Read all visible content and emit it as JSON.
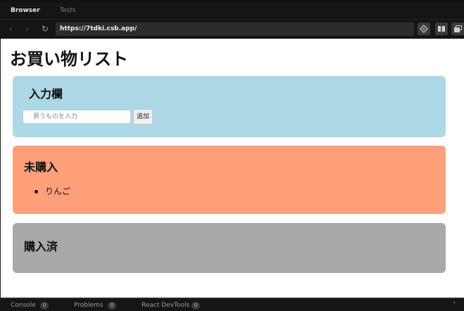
{
  "tabs": [
    {
      "label": "Browser"
    },
    {
      "label": "Tests"
    }
  ],
  "toolbar": {
    "url": "https://7tdki.csb.app/"
  },
  "page": {
    "title": "お買い物リスト",
    "input_section": {
      "title": "入力欄",
      "input_placeholder": "買うものを入力",
      "input_value": "",
      "add_button_label": "追加"
    },
    "unbought_section": {
      "title": "未購入",
      "items": [
        "りんご"
      ]
    },
    "bought_section": {
      "title": "購入済",
      "items": []
    }
  },
  "devtools": {
    "tabs": [
      {
        "label": "Console",
        "count": "0"
      },
      {
        "label": "Problems",
        "count": "0"
      },
      {
        "label": "React DevTools",
        "count": "0"
      }
    ]
  },
  "colors": {
    "input_card": "#add8e6",
    "unbought_card": "#ffa07a",
    "bought_card": "#a9a9a9"
  },
  "icons": [
    "arrow-left-icon",
    "arrow-right-icon",
    "reload-icon",
    "codesandbox-icon",
    "split-view-icon",
    "open-window-icon",
    "chevron-up-icon"
  ]
}
